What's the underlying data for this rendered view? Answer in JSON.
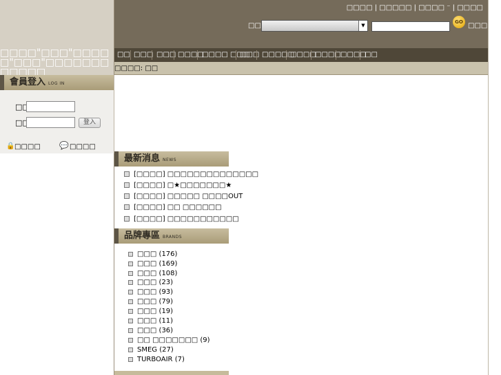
{
  "sidebar": {
    "marquee_text": "□□□□\"□□□\"□□□□□\"□□□\"□□□□□□□□□□□□",
    "login": {
      "title": "會員登入",
      "title_small": "LOG IN",
      "account_label": "□□",
      "password_label": "□□",
      "login_button": "登入",
      "forgot_link": "□□□□",
      "register_link": "□□□□"
    }
  },
  "header": {
    "top_links": "□□□□ | □□□□□ | □□□□ ⁻ | □□□□",
    "search_label": "□□:",
    "search_select_value": "",
    "search_input_value": "",
    "go_button": "GO",
    "advanced_search": "□□□□"
  },
  "nav": {
    "items": [
      "□□",
      "□□□",
      "□□□",
      "□□□□",
      "□□□□ □□□",
      "□□□",
      "□□□□□",
      "□□□□",
      "□□□□",
      "□□□□",
      "□□"
    ]
  },
  "breadcrumb": "□□□□: □□",
  "news": {
    "title": "最新消息",
    "title_small": "NEWS",
    "items": [
      "[□□□□] □□□□□□□□□□□□□□",
      "[□□□□] □★□□□□□□□★",
      "[□□□□] □□□□□ □□□□OUT",
      "[□□□□] □□ □□□□□□",
      "[□□□□] □□□□□□□□□□□"
    ]
  },
  "brands": {
    "title": "品牌專區",
    "title_small": "BRANDS",
    "items": [
      {
        "name": "□□□",
        "count": "(176)"
      },
      {
        "name": "□□□",
        "count": "(169)"
      },
      {
        "name": "□□□",
        "count": "(108)"
      },
      {
        "name": "□□□",
        "count": "(23)"
      },
      {
        "name": "□□□",
        "count": "(93)"
      },
      {
        "name": "□□□",
        "count": "(79)"
      },
      {
        "name": "□□□",
        "count": "(19)"
      },
      {
        "name": "□□□",
        "count": "(11)"
      },
      {
        "name": "□□□",
        "count": "(36)"
      },
      {
        "name": "□□ □□□□□□□",
        "count": "(9)"
      },
      {
        "name": "SMEG",
        "count": "(27)"
      },
      {
        "name": "TURBOAIR",
        "count": "(7)"
      }
    ]
  },
  "colors": {
    "header_bg": "#756b5a",
    "nav_bg": "#4f4738",
    "section_head": "#b3a684",
    "go_button": "#f0b800"
  }
}
